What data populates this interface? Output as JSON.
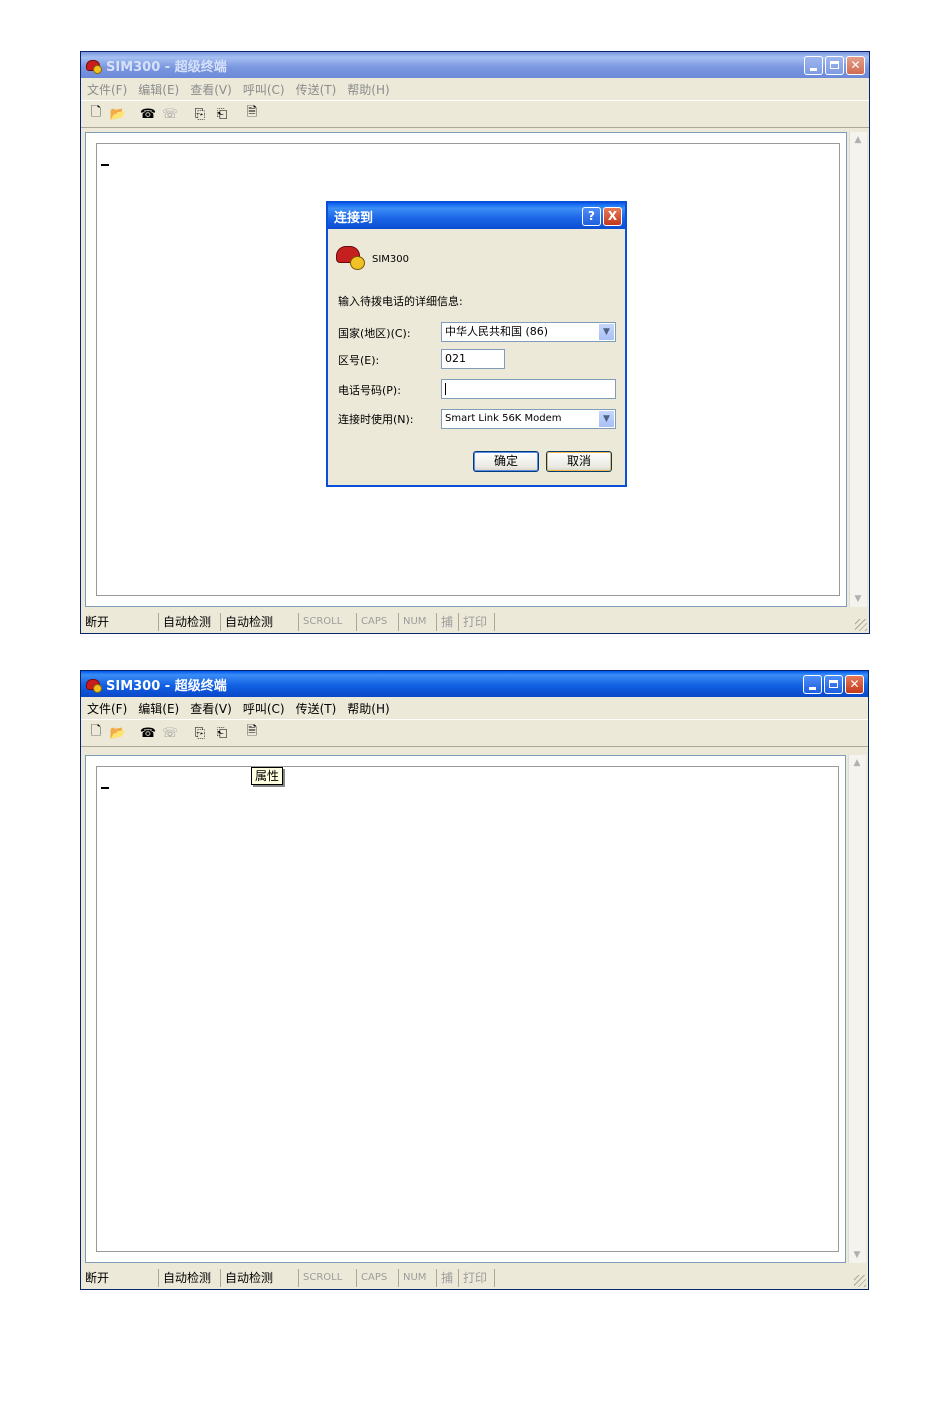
{
  "window1": {
    "title": "SIM300 - 超级终端",
    "menu": [
      "文件(F)",
      "编辑(E)",
      "查看(V)",
      "呼叫(C)",
      "传送(T)",
      "帮助(H)"
    ],
    "cursor": "_",
    "status": [
      "断开",
      "自动检测",
      "自动检测",
      "SCROLL",
      "CAPS",
      "NUM",
      "捕",
      "打印"
    ]
  },
  "dialog": {
    "title": "连接到",
    "help_label": "?",
    "close_label": "X",
    "connection_name": "SIM300",
    "prompt": "输入待拨电话的详细信息:",
    "country_label": "国家(地区)(C):",
    "country_value": "中华人民共和国 (86)",
    "area_label": "区号(E):",
    "area_value": "021",
    "phone_label": "电话号码(P):",
    "phone_value": "",
    "connect_using_label": "连接时使用(N):",
    "connect_using_value": "Smart Link 56K Modem",
    "ok_label": "确定",
    "cancel_label": "取消"
  },
  "window2": {
    "title": "SIM300 - 超级终端",
    "menu": [
      "文件(F)",
      "编辑(E)",
      "查看(V)",
      "呼叫(C)",
      "传送(T)",
      "帮助(H)"
    ],
    "tooltip": "属性",
    "cursor": "_",
    "status": [
      "断开",
      "自动检测",
      "自动检测",
      "SCROLL",
      "CAPS",
      "NUM",
      "捕",
      "打印"
    ]
  },
  "icons": {
    "toolbar": [
      "new-icon",
      "open-icon",
      "dial-icon",
      "disconnect-icon",
      "send-icon",
      "receive-icon",
      "properties-icon"
    ]
  },
  "colors": {
    "titlebar_active": "#0058ee",
    "titlebar_inactive": "#7a96df",
    "window_face": "#ece9d8",
    "tooltip_bg": "#ffffe1"
  }
}
